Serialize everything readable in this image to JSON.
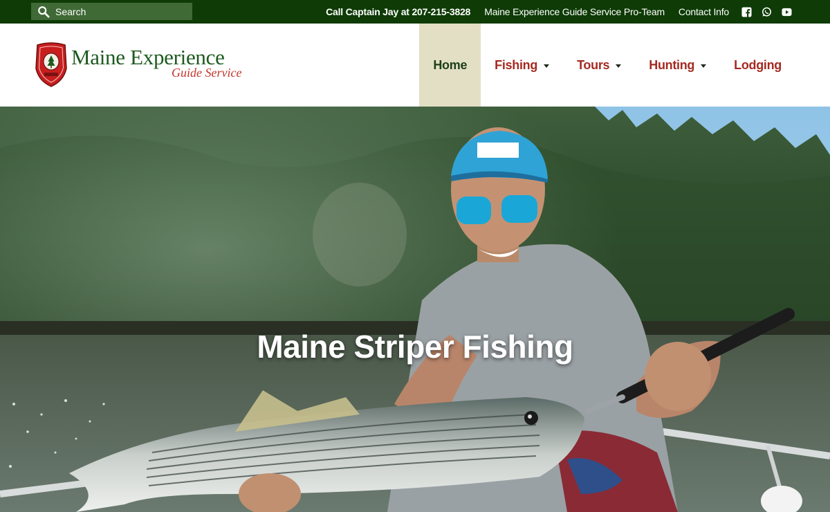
{
  "topbar": {
    "search_placeholder": "Search",
    "call": "Call Captain Jay at 207-215-3828",
    "pro_team": "Maine Experience Guide Service Pro-Team",
    "contact": "Contact Info",
    "social_icons": [
      "facebook-icon",
      "whatsapp-icon",
      "youtube-icon"
    ]
  },
  "logo": {
    "main": "Maine Experience",
    "sub": "Guide Service"
  },
  "nav": {
    "items": [
      {
        "label": "Home",
        "active": true,
        "dropdown": false
      },
      {
        "label": "Fishing",
        "active": false,
        "dropdown": true
      },
      {
        "label": "Tours",
        "active": false,
        "dropdown": true
      },
      {
        "label": "Hunting",
        "active": false,
        "dropdown": true
      },
      {
        "label": "Lodging",
        "active": false,
        "dropdown": false
      }
    ]
  },
  "hero": {
    "title": "Maine Striper Fishing"
  },
  "colors": {
    "topbar_bg": "#0e3b06",
    "search_bg": "#3f6a36",
    "nav_text": "#a42a21",
    "nav_active_bg": "#e3dfc4",
    "logo_green": "#1d5a1f",
    "logo_red": "#c4352b"
  }
}
